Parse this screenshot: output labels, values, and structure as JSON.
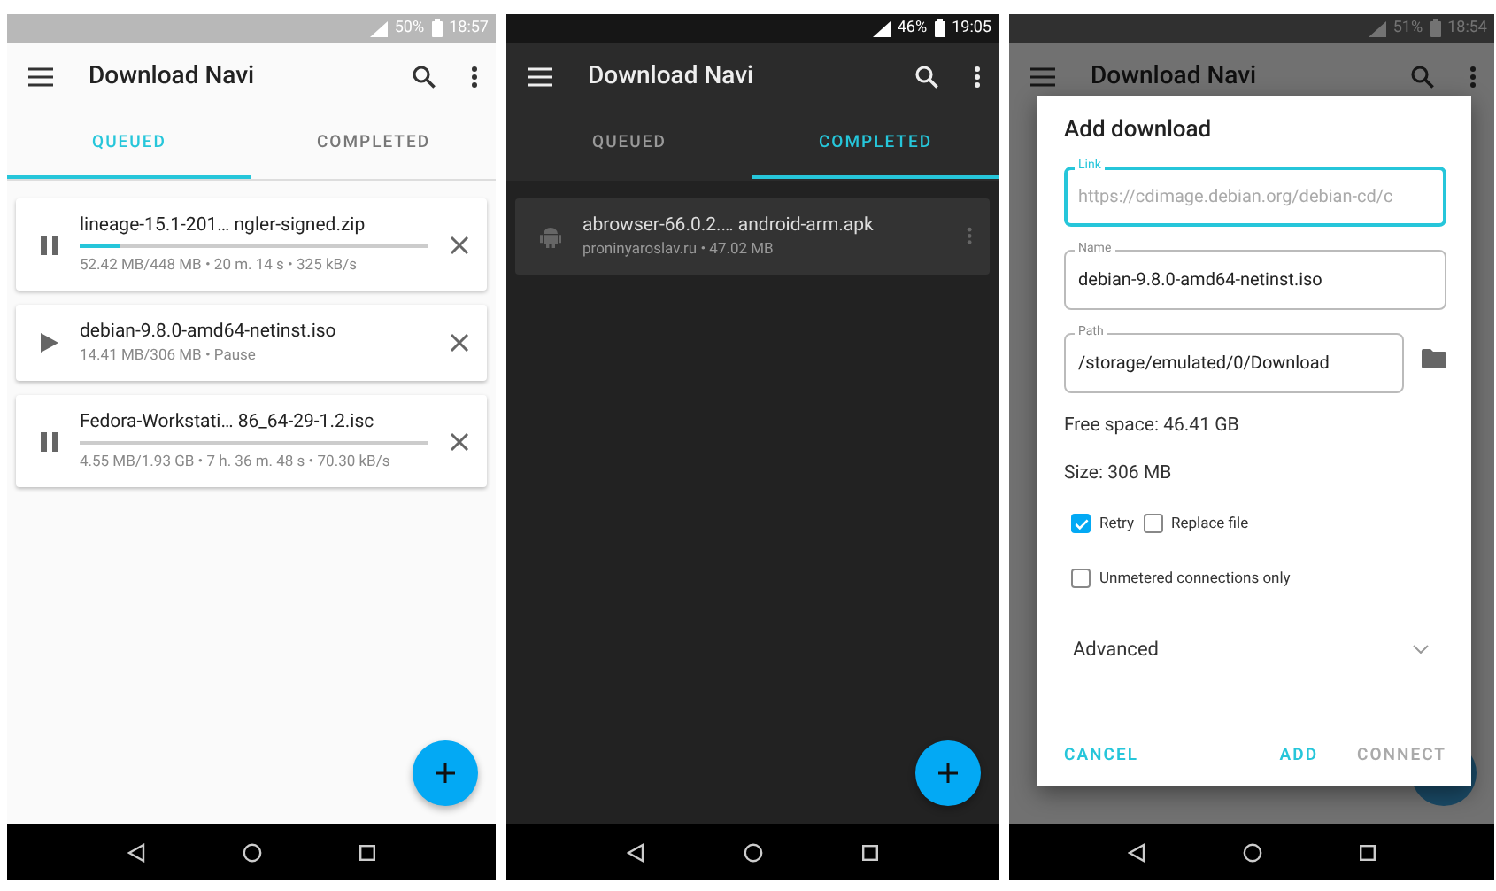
{
  "screens": [
    {
      "kind": "list",
      "dark": false,
      "status_bar": {
        "battery": "50%",
        "time": "18:57"
      },
      "app_bar": {
        "title": "Download Navi"
      },
      "tabs": [
        {
          "label": "QUEUED",
          "selected": true
        },
        {
          "label": "COMPLETED",
          "selected": false
        }
      ],
      "downloads": [
        {
          "name": "lineage-15.1-201… ngler-signed.zip",
          "paused": false,
          "level": 0.117,
          "info": "52.42 MB/448 MB • 20 m. 14 s • 325 kB/s"
        },
        {
          "name": "debian-9.8.0-amd64-netinst.iso",
          "paused": true,
          "info": "14.41 MB/306 MB • Pause"
        },
        {
          "name": "Fedora-Workstati… 86_64-29-1.2.isc",
          "paused": false,
          "level": 0,
          "info": "4.55 MB/1.93 GB • 7 h. 36 m. 48 s • 70.30 kB/s"
        }
      ]
    },
    {
      "kind": "list",
      "dark": true,
      "status_bar": {
        "battery": "46%",
        "time": "19:05"
      },
      "app_bar": {
        "title": "Download Navi"
      },
      "tabs": [
        {
          "label": "QUEUED",
          "selected": false
        },
        {
          "label": "COMPLETED",
          "selected": true
        }
      ],
      "completed": [
        {
          "name": "abrowser-66.0.2.… android-arm.apk",
          "info": "proninyaroslav.ru • 47.02 MB"
        }
      ]
    },
    {
      "kind": "dialog",
      "dark": false,
      "status_bar": {
        "battery": "51%",
        "time": "18:54"
      },
      "app_bar": {
        "title": "Download Navi"
      },
      "dialog": {
        "title": "Add download",
        "fields": [
          {
            "label": "Link",
            "placeholder": "https://cdimage.debian.org/debian-cd/c",
            "focused": true
          },
          {
            "label": "Name",
            "value": "debian-9.8.0-amd64-netinst.iso",
            "focused": false
          },
          {
            "label": "Path",
            "value": "/storage/emulated/0/Download",
            "focused": false,
            "folder": true
          }
        ],
        "free_space": "Free space: 46.41 GB",
        "size": "Size: 306 MB",
        "checkbox_rows": [
          [
            {
              "label": "Retry",
              "checked": true
            },
            {
              "label": "Replace file",
              "checked": false
            }
          ],
          [
            {
              "label": "Unmetered connections only",
              "checked": false
            }
          ]
        ],
        "advanced": {
          "label": "Advanced",
          "expanded": false
        },
        "buttons": [
          {
            "label": "CANCEL",
            "disabled": false
          },
          {
            "label": "ADD",
            "disabled": false
          },
          {
            "label": "CONNECT",
            "disabled": true
          }
        ]
      }
    }
  ]
}
